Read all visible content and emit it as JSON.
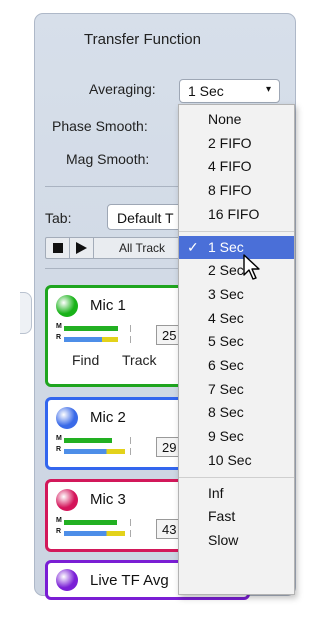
{
  "panel": {
    "title": "Transfer Function"
  },
  "settings": {
    "averaging_label": "Averaging:",
    "averaging_value": "1 Sec",
    "phase_smooth_label": "Phase Smooth:",
    "mag_smooth_label": "Mag Smooth:"
  },
  "tab": {
    "label": "Tab:",
    "value": "Default T"
  },
  "transport": {
    "all_tracks_label": "All Track"
  },
  "cards": [
    {
      "name": "Mic 1",
      "color": "#1fa51f",
      "dot": "#18b218",
      "level": "25",
      "find_label": "Find",
      "track_label": "Track",
      "meter_m": 0.68,
      "meter_r": 0.68
    },
    {
      "name": "Mic 2",
      "color": "#3366ee",
      "dot": "#3a6ae8",
      "level": "29",
      "meter_m": 0.6,
      "meter_r": 0.76
    },
    {
      "name": "Mic 3",
      "color": "#d2185a",
      "dot": "#d4145a",
      "level": "43",
      "meter_m": 0.66,
      "meter_r": 0.76
    },
    {
      "name": "Live TF Avg",
      "color": "#7a1ed4",
      "dot": "#7a1fd6"
    }
  ],
  "dropdown": {
    "options_group1": [
      "None",
      "2 FIFO",
      "4 FIFO",
      "8 FIFO",
      "16 FIFO"
    ],
    "selected": "1 Sec",
    "check_mark": "✓",
    "options_group2": [
      "1 Sec",
      "2 Sec",
      "3 Sec",
      "4 Sec",
      "5 Sec",
      "6 Sec",
      "7 Sec",
      "8 Sec",
      "9 Sec",
      "10 Sec"
    ],
    "options_group3": [
      "Inf",
      "Fast",
      "Slow"
    ]
  },
  "colors": {
    "accent": "#4a6fd8",
    "meter_green": "#22b022",
    "meter_blue": "#4d8ee8",
    "meter_yellow": "#e3d21a"
  },
  "icons": {
    "averaging_caret": "▾",
    "cursor": "mouse-pointer-icon"
  }
}
